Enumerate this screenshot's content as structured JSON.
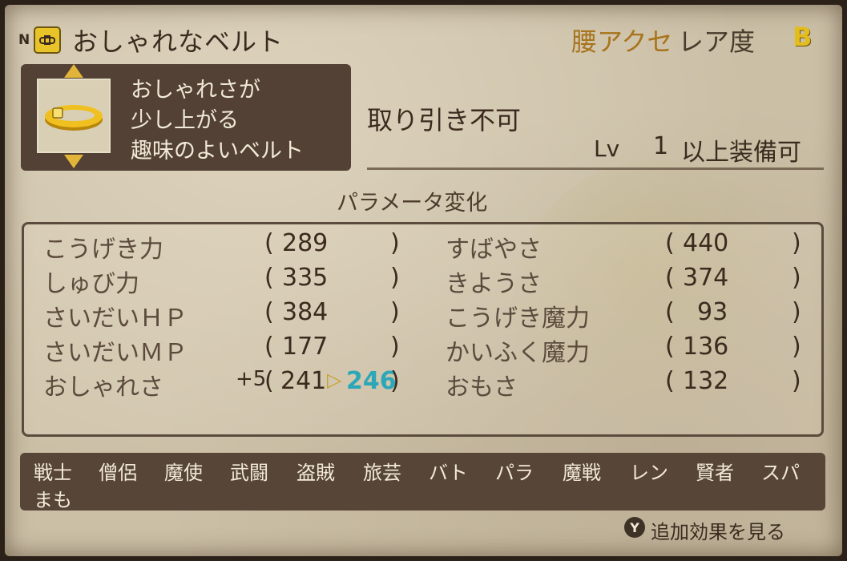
{
  "header": {
    "item_name": "おしゃれなベルト",
    "category": "腰アクセ",
    "rarity_label": "レア度",
    "rarity_value": "B",
    "prefix_letter": "N"
  },
  "description": {
    "lines": [
      "おしゃれさが",
      "少し上がる",
      "趣味のよいベルト"
    ]
  },
  "trade": "取り引き不可",
  "level": {
    "label": "Lv",
    "value": "1",
    "suffix": "以上装備可"
  },
  "param_title": "パラメータ変化",
  "stats_left": [
    {
      "name": "こうげき力",
      "prefix": "",
      "value": "289",
      "new": ""
    },
    {
      "name": "しゅび力",
      "prefix": "",
      "value": "335",
      "new": ""
    },
    {
      "name": "さいだいＨＰ",
      "prefix": "",
      "value": "384",
      "new": ""
    },
    {
      "name": "さいだいＭＰ",
      "prefix": "",
      "value": "177",
      "new": ""
    },
    {
      "name": "おしゃれさ",
      "prefix": "+5",
      "value": "241",
      "new": "246"
    }
  ],
  "stats_right": [
    {
      "name": "すばやさ",
      "value": "440"
    },
    {
      "name": "きようさ",
      "value": "374"
    },
    {
      "name": "こうげき魔力",
      "value": "93"
    },
    {
      "name": "かいふく魔力",
      "value": "136"
    },
    {
      "name": "おもさ",
      "value": "132"
    }
  ],
  "jobs": [
    "戦士",
    "僧侶",
    "魔使",
    "武闘",
    "盗賊",
    "旅芸",
    "バト",
    "パラ",
    "魔戦",
    "レン",
    "賢者",
    "スパ",
    "まも"
  ],
  "footer": {
    "button": "Y",
    "label": "追加効果を見る"
  },
  "icons": {
    "header": "belt-item-icon",
    "thumbnail": "belt-ring-icon",
    "arrow_up": "arrow-up-icon",
    "arrow_down": "arrow-down-icon"
  },
  "colors": {
    "category": "#a8741c",
    "rarity": "#e2bd1c",
    "new_value": "#2ba7b7"
  }
}
